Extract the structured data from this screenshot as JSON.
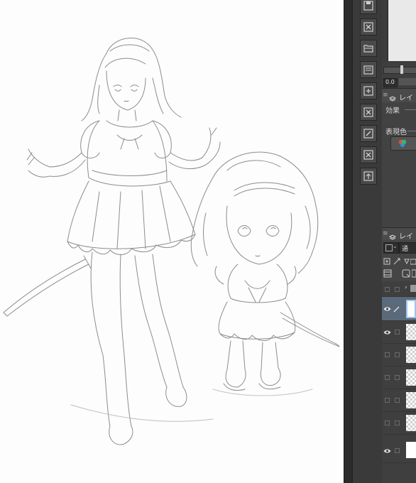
{
  "panel": {
    "slider_value": "0.0",
    "layer_property_tab": "レイ",
    "effect_label": "効果",
    "expression_color_label": "表現色",
    "layer_tab": "レイ",
    "blend_mode_label": "通"
  },
  "toolstrip": {
    "buttons": [
      "save-icon",
      "close-icon",
      "open-folder-icon",
      "folder-save-icon",
      "transform-icon",
      "close-icon",
      "edit-icon",
      "close-icon",
      "export-icon"
    ]
  },
  "layers": [
    {
      "visible": false,
      "thumb": "folder",
      "selected": false
    },
    {
      "visible": true,
      "thumb": "white",
      "selected": true
    },
    {
      "visible": true,
      "thumb": "transparent",
      "selected": false
    },
    {
      "visible": false,
      "thumb": "transparent",
      "selected": false
    },
    {
      "visible": false,
      "thumb": "transparent",
      "selected": false
    },
    {
      "visible": false,
      "thumb": "transparent",
      "selected": false
    },
    {
      "visible": false,
      "thumb": "transparent",
      "selected": false
    },
    {
      "visible": true,
      "thumb": "white",
      "selected": false
    }
  ],
  "colors": {
    "panel_bg": "#424242",
    "toolstrip_bg": "#3a3a3a",
    "selected_layer": "#5a6a7a",
    "sketch_line": "#8a8a8a"
  }
}
